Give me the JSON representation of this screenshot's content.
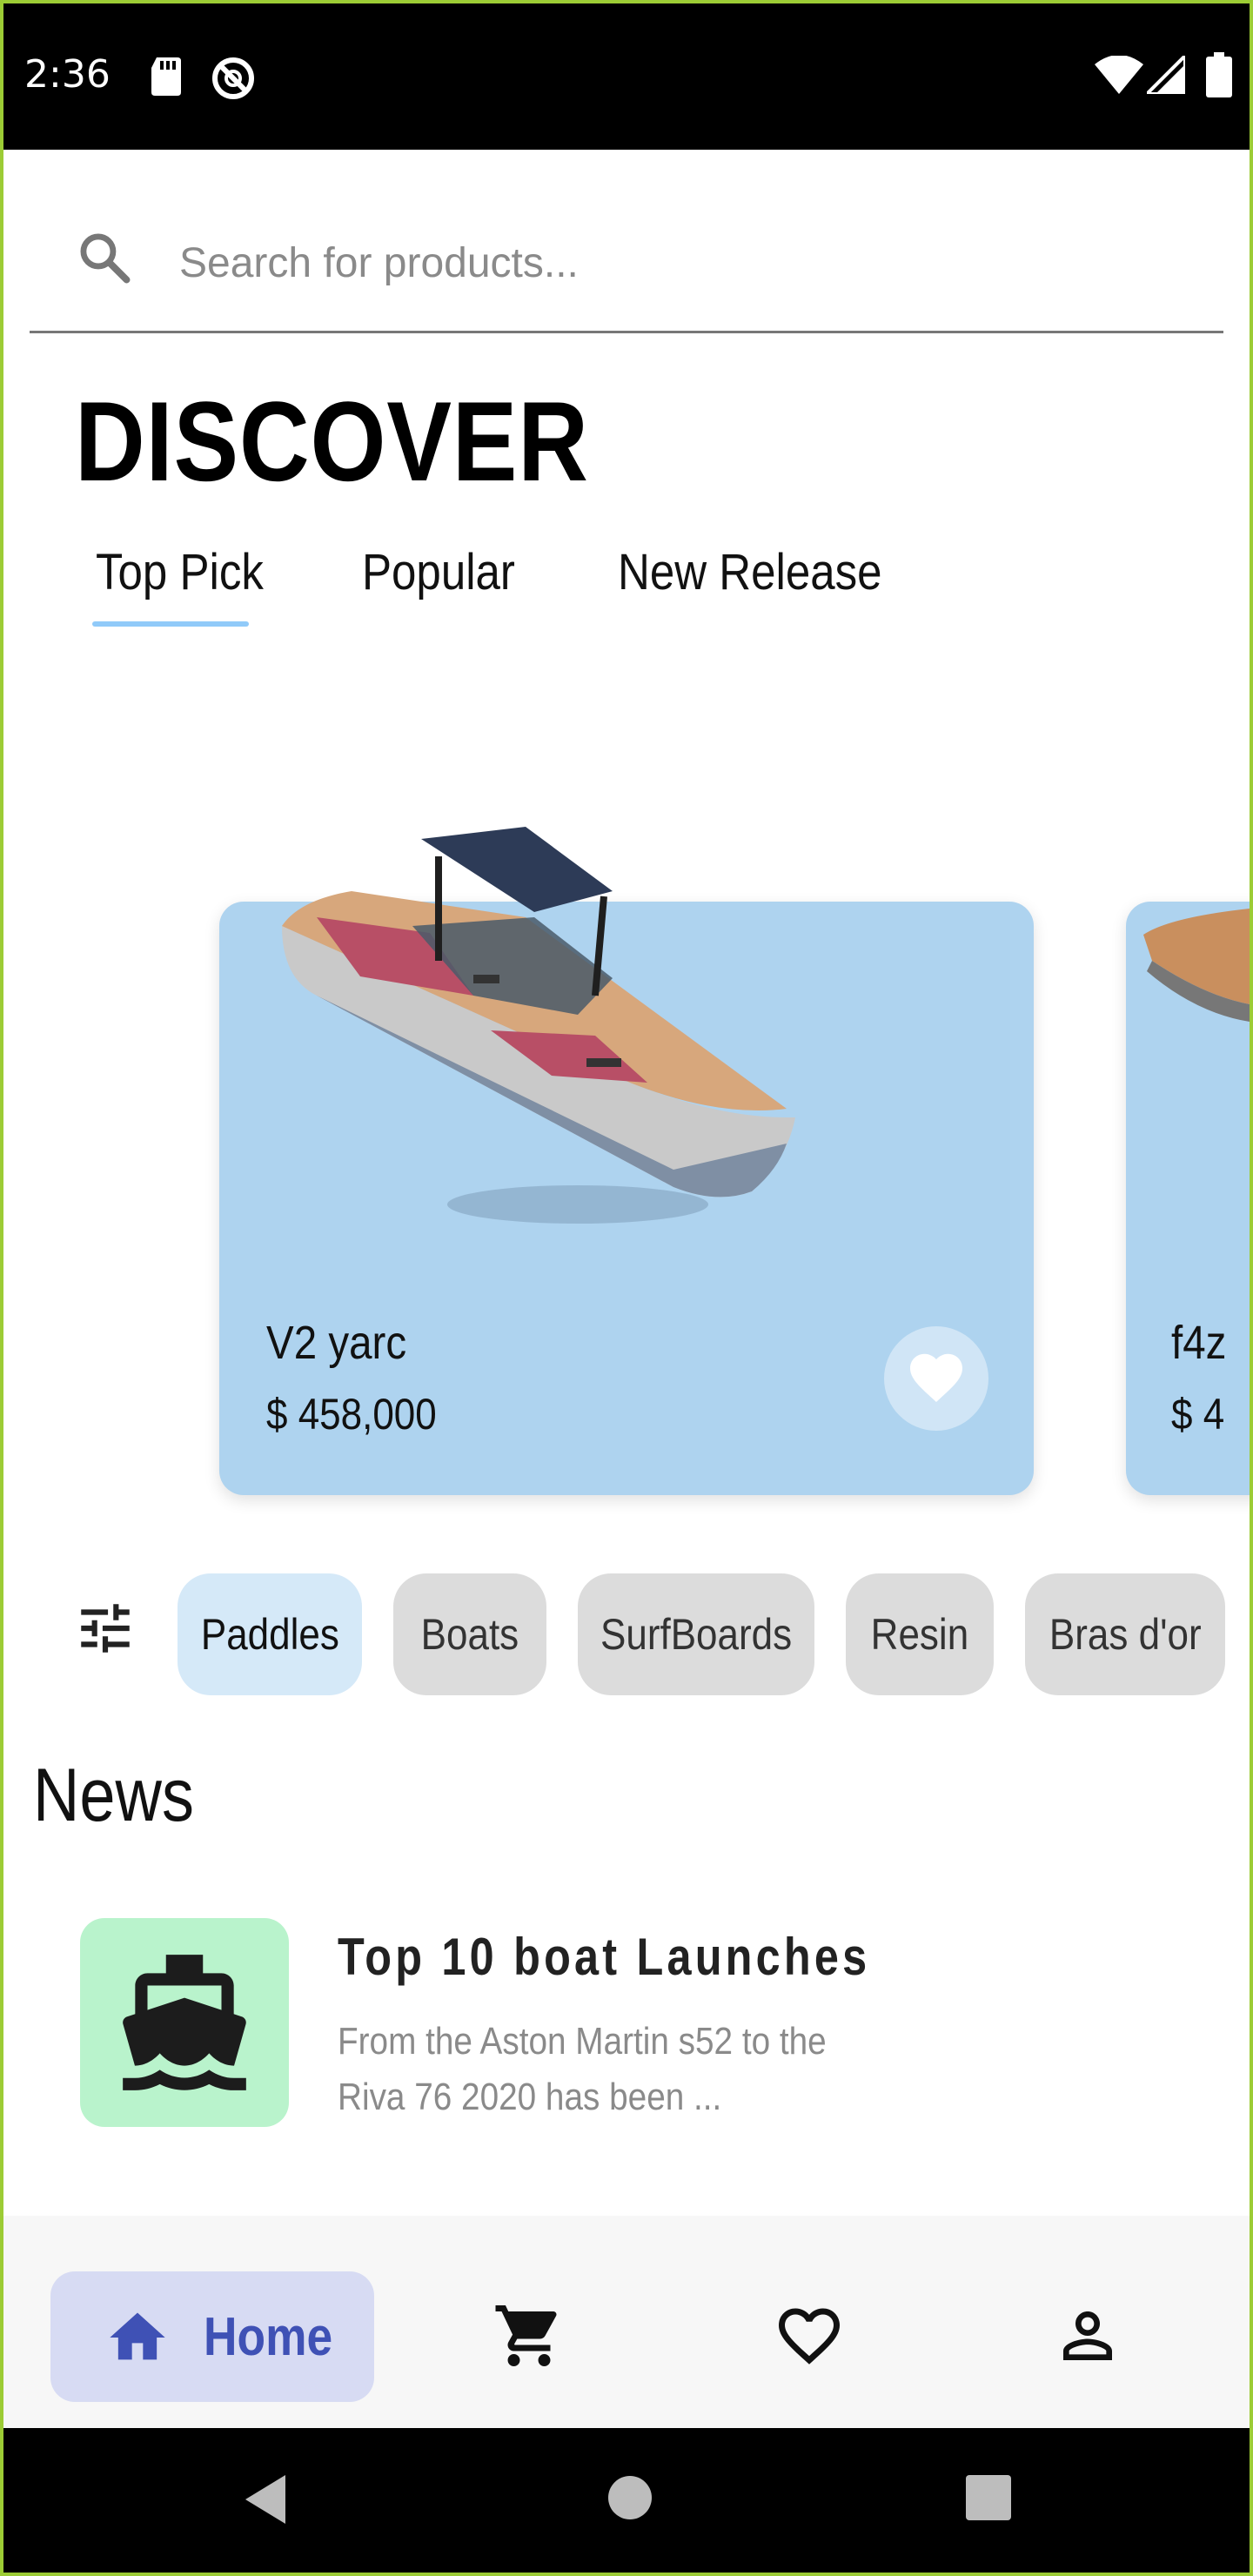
{
  "status_bar": {
    "time": "2:36"
  },
  "search": {
    "placeholder": "Search for products..."
  },
  "page": {
    "title": "DISCOVER"
  },
  "tabs": [
    {
      "label": "Top Pick",
      "selected": true
    },
    {
      "label": "Popular",
      "selected": false
    },
    {
      "label": "New Release",
      "selected": false
    }
  ],
  "products": [
    {
      "name": "V2 yarc",
      "price": "$ 458,000"
    },
    {
      "name": "f4z",
      "price": "$ 4"
    }
  ],
  "categories": [
    {
      "label": "Paddles",
      "selected": true
    },
    {
      "label": "Boats",
      "selected": false
    },
    {
      "label": "SurfBoards",
      "selected": false
    },
    {
      "label": "Resin",
      "selected": false
    },
    {
      "label": "Bras d'or",
      "selected": false
    }
  ],
  "news": {
    "heading": "News",
    "items": [
      {
        "title": "Top 10 boat Launches",
        "description": "From the Aston Martin s52 to the Riva 76 2020 has been ..."
      }
    ]
  },
  "bottom_nav": {
    "home_label": "Home",
    "items": [
      "home-icon",
      "cart-icon",
      "heart-outline-icon",
      "person-icon"
    ]
  },
  "colors": {
    "accent": "#3f51b5",
    "card_background": "#aed3ef",
    "tab_underline": "#90caf9",
    "news_thumb": "#b9f3cc",
    "chip_active": "#d5e9f8",
    "chip_inactive": "#dcdcdc"
  }
}
